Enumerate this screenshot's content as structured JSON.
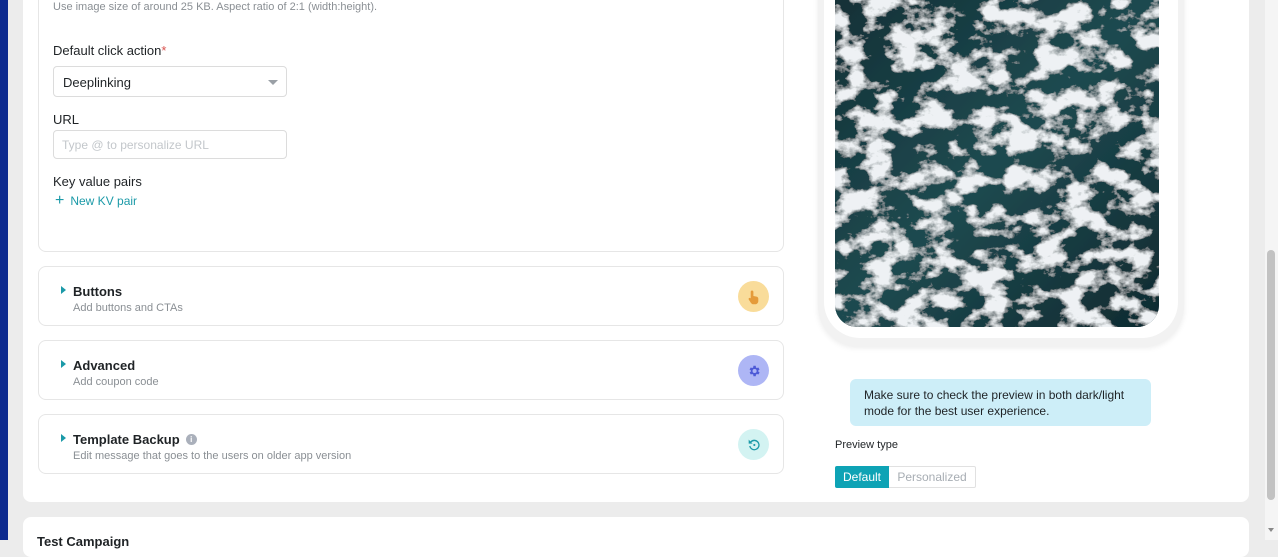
{
  "form": {
    "image_hint": "Use image size of around 25 KB. Aspect ratio of 2:1 (width:height).",
    "click_action_label": "Default click action",
    "required_mark": "*",
    "click_action_value": "Deeplinking",
    "url_label": "URL",
    "url_placeholder": "Type @ to personalize URL",
    "kv_label": "Key value pairs",
    "kv_add": "New KV pair"
  },
  "sections": [
    {
      "title": "Buttons",
      "subtitle": "Add buttons and CTAs",
      "icon": "pointer-hand-icon",
      "icon_bg": "#f9dc9a",
      "icon_color": "#e59b3a"
    },
    {
      "title": "Advanced",
      "subtitle": "Add coupon code",
      "icon": "gear-icon",
      "icon_bg": "#aeb6f5",
      "icon_color": "#4d5ad6"
    },
    {
      "title": "Template Backup",
      "subtitle": "Edit message that goes to the users on older app version",
      "icon": "restore-icon",
      "icon_bg": "#d3f3f2",
      "icon_color": "#1b9aa8",
      "info": "i"
    }
  ],
  "preview": {
    "tip": "Make sure to check the preview in both dark/light mode for the best user experience.",
    "type_label": "Preview type",
    "types": [
      "Default",
      "Personalized"
    ],
    "selected": "Default"
  },
  "test_campaign": {
    "title": "Test Campaign"
  },
  "colors": {
    "accent": "#0ea3b5",
    "link": "#1b9aa8",
    "sidebar": "#0d2a8f"
  }
}
